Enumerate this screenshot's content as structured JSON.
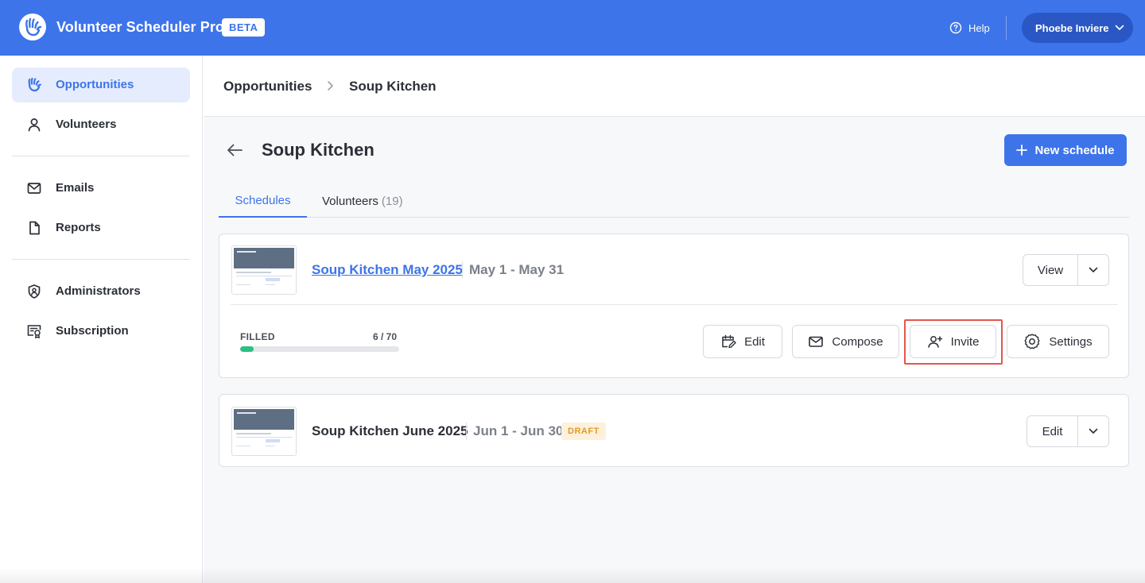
{
  "header": {
    "app_title": "Volunteer Scheduler Pro",
    "beta_badge": "BETA",
    "help_label": "Help",
    "user_name": "Phoebe Inviere",
    "brand_color": "#3d74ea"
  },
  "sidebar": {
    "items": [
      {
        "label": "Opportunities",
        "icon": "waving-hand-icon",
        "active": true
      },
      {
        "label": "Volunteers",
        "icon": "person-icon",
        "active": false
      },
      {
        "label": "Emails",
        "icon": "envelope-icon",
        "active": false
      },
      {
        "label": "Reports",
        "icon": "document-icon",
        "active": false
      },
      {
        "label": "Administrators",
        "icon": "shield-user-icon",
        "active": false
      },
      {
        "label": "Subscription",
        "icon": "certificate-icon",
        "active": false
      }
    ]
  },
  "breadcrumb": {
    "parent": "Opportunities",
    "current": "Soup Kitchen"
  },
  "page": {
    "title": "Soup Kitchen",
    "new_schedule_label": "New schedule"
  },
  "tabs": [
    {
      "label": "Schedules",
      "count": "",
      "active": true
    },
    {
      "label": "Volunteers",
      "count": "(19)",
      "active": false
    }
  ],
  "schedules": [
    {
      "name": "Soup Kitchen May 2025",
      "dates": "May 1 - May 31",
      "primary_action": "View",
      "filled_label": "FILLED",
      "filled_count": "6 / 70",
      "filled_fraction": 0.0857,
      "actions": [
        "Edit",
        "Compose",
        "Invite",
        "Settings"
      ],
      "highlighted_action": "Invite"
    },
    {
      "name": "Soup Kitchen June 2025",
      "dates": "Jun 1 - Jun 30",
      "status_badge": "DRAFT",
      "primary_action": "Edit"
    }
  ],
  "colors": {
    "progress": "#2bbf84",
    "highlight": "#e2574c",
    "draft_text": "#e39a22"
  }
}
